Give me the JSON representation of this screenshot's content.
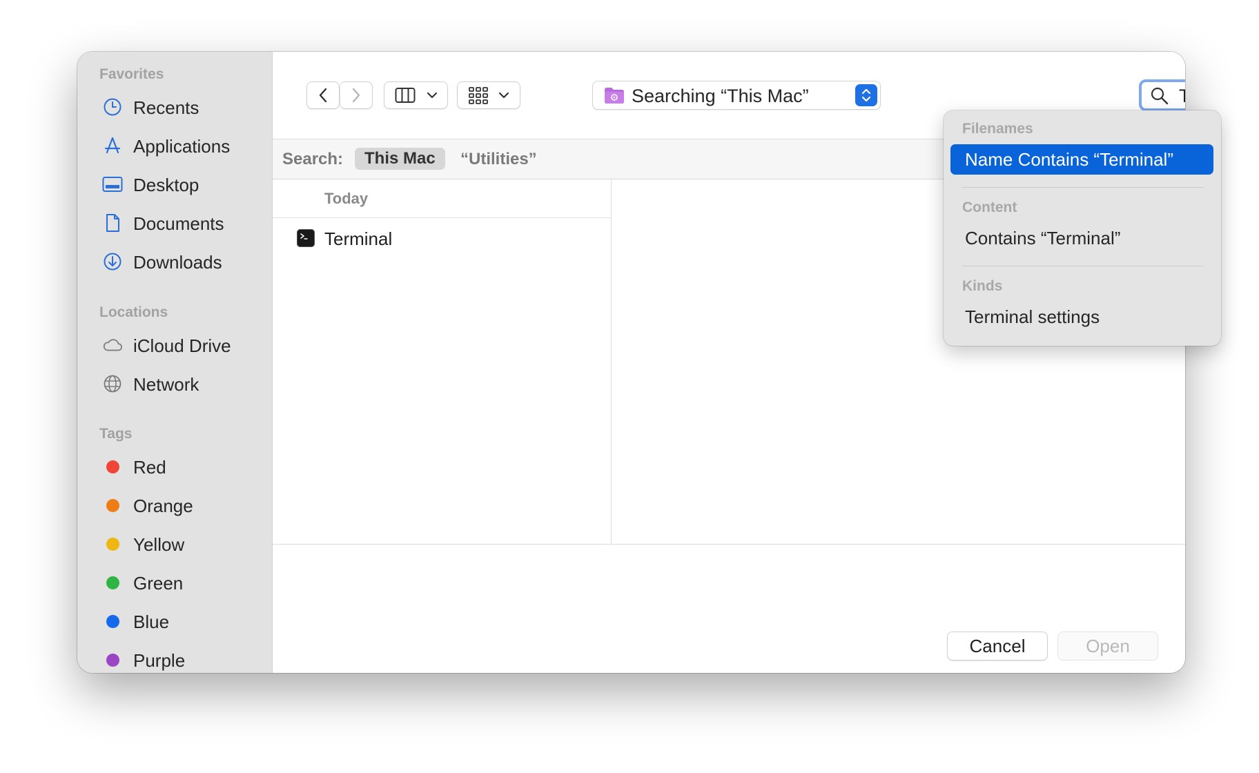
{
  "sidebar": {
    "favorites_title": "Favorites",
    "favorites": [
      {
        "label": "Recents",
        "icon": "clock-icon"
      },
      {
        "label": "Applications",
        "icon": "applications-icon"
      },
      {
        "label": "Desktop",
        "icon": "desktop-icon"
      },
      {
        "label": "Documents",
        "icon": "document-icon"
      },
      {
        "label": "Downloads",
        "icon": "download-icon"
      }
    ],
    "locations_title": "Locations",
    "locations": [
      {
        "label": "iCloud Drive",
        "icon": "cloud-icon"
      },
      {
        "label": "Network",
        "icon": "globe-icon"
      }
    ],
    "tags_title": "Tags",
    "tags": [
      {
        "label": "Red",
        "color": "#f0463a"
      },
      {
        "label": "Orange",
        "color": "#ee7d16"
      },
      {
        "label": "Yellow",
        "color": "#eeb711"
      },
      {
        "label": "Green",
        "color": "#2fb544"
      },
      {
        "label": "Blue",
        "color": "#1669ea"
      },
      {
        "label": "Purple",
        "color": "#9b45c5"
      }
    ]
  },
  "toolbar": {
    "location_label": "Searching “This Mac”",
    "location_icon": "smart-folder-icon"
  },
  "search": {
    "value": "Terminal"
  },
  "scope": {
    "label": "Search:",
    "this_mac": "This Mac",
    "utilities": "“Utilities”"
  },
  "list": {
    "header": "Today",
    "files": [
      {
        "name": "Terminal",
        "icon": "terminal-app-icon"
      }
    ]
  },
  "footer": {
    "cancel": "Cancel",
    "open": "Open"
  },
  "suggestions": {
    "filenames_title": "Filenames",
    "filenames_item": "Name Contains “Terminal”",
    "content_title": "Content",
    "content_item": "Contains “Terminal”",
    "kinds_title": "Kinds",
    "kinds_item": "Terminal settings"
  },
  "colors": {
    "accent": "#0a64d9",
    "focus_ring": "#7fa9ec",
    "sidebar_bg": "#e2e2e2",
    "sidebar_icon": "#2a6fd8"
  }
}
